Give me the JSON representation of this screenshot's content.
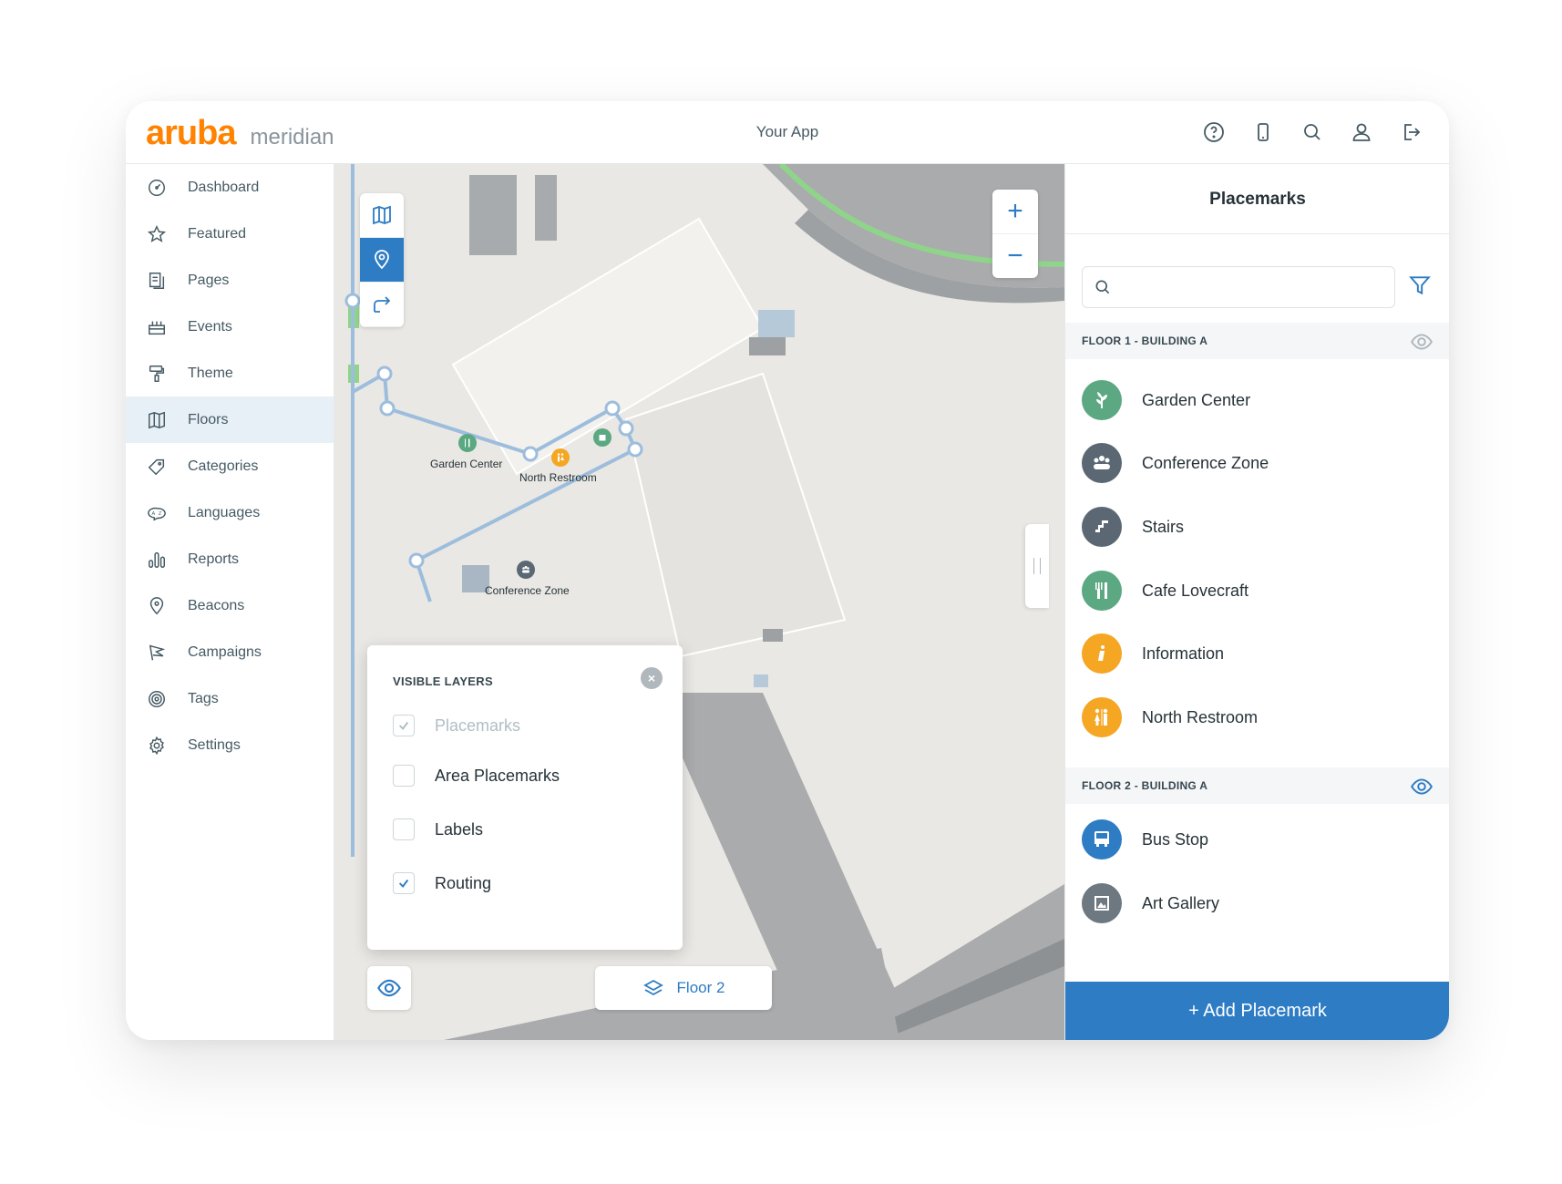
{
  "header": {
    "brand_primary": "aruba",
    "brand_secondary": "meridian",
    "app_title": "Your App",
    "icons": [
      "help-icon",
      "mobile-icon",
      "search-icon",
      "user-icon",
      "logout-icon"
    ]
  },
  "sidebar": {
    "items": [
      {
        "label": "Dashboard",
        "icon": "dashboard-icon"
      },
      {
        "label": "Featured",
        "icon": "star-icon"
      },
      {
        "label": "Pages",
        "icon": "pages-icon"
      },
      {
        "label": "Events",
        "icon": "events-icon"
      },
      {
        "label": "Theme",
        "icon": "theme-icon"
      },
      {
        "label": "Floors",
        "icon": "map-icon",
        "active": true
      },
      {
        "label": "Categories",
        "icon": "tag-icon"
      },
      {
        "label": "Languages",
        "icon": "languages-icon"
      },
      {
        "label": "Reports",
        "icon": "reports-icon"
      },
      {
        "label": "Beacons",
        "icon": "beacon-icon"
      },
      {
        "label": "Campaigns",
        "icon": "flag-icon"
      },
      {
        "label": "Tags",
        "icon": "tags-icon"
      },
      {
        "label": "Settings",
        "icon": "gear-icon"
      }
    ]
  },
  "map": {
    "labels": {
      "garden_center": "Garden Center",
      "north_restroom": "North Restroom",
      "conference_zone": "Conference Zone"
    },
    "zoom_in": "+",
    "zoom_out": "−",
    "floor_button": "Floor 2"
  },
  "layers": {
    "title": "VISIBLE LAYERS",
    "close": "×",
    "items": [
      {
        "label": "Placemarks",
        "checked": true,
        "disabled": true
      },
      {
        "label": "Area Placemarks",
        "checked": false
      },
      {
        "label": "Labels",
        "checked": false
      },
      {
        "label": "Routing",
        "checked": true
      }
    ]
  },
  "panel": {
    "title": "Placemarks",
    "search_placeholder": "",
    "floors": [
      {
        "heading": "FLOOR 1 - BUILDING A",
        "placemarks": [
          {
            "label": "Garden Center",
            "icon": "leaf-icon",
            "color": "#5ba882"
          },
          {
            "label": "Conference Zone",
            "icon": "group-icon",
            "color": "#5b6874"
          },
          {
            "label": "Stairs",
            "icon": "stairs-icon",
            "color": "#5b6874"
          },
          {
            "label": "Cafe Lovecraft",
            "icon": "fork-knife-icon",
            "color": "#5ba882"
          },
          {
            "label": "Information",
            "icon": "info-icon",
            "color": "#f5a623"
          },
          {
            "label": "North Restroom",
            "icon": "restroom-icon",
            "color": "#f5a623"
          }
        ]
      },
      {
        "heading": "FLOOR 2 - BUILDING A",
        "placemarks": [
          {
            "label": "Bus Stop",
            "icon": "bus-icon",
            "color": "#2e7cc4"
          },
          {
            "label": "Art Gallery",
            "icon": "picture-icon",
            "color": "#6d7880"
          }
        ]
      }
    ],
    "add_button": "+ Add Placemark"
  },
  "colors": {
    "accent": "#2e7cc4",
    "brand": "#ff8300",
    "active_nav_bg": "#e8f0f7"
  }
}
